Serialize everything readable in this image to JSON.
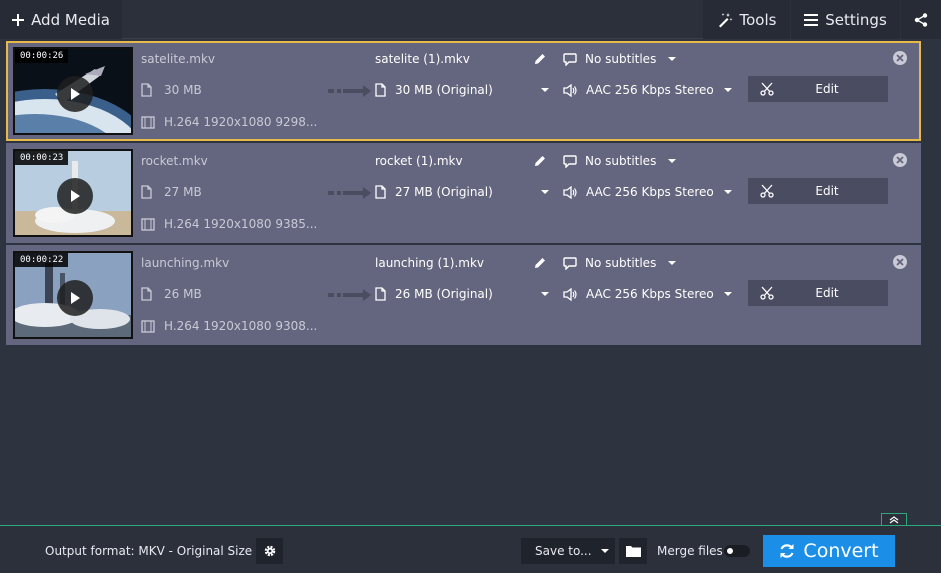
{
  "toolbar": {
    "add_media_label": "Add Media",
    "tools_label": "Tools",
    "settings_label": "Settings"
  },
  "files": [
    {
      "duration": "00:00:26",
      "source_name": "satelite.mkv",
      "source_size": "30 MB",
      "source_codec": "H.264 1920x1080 9298...",
      "output_name": "satelite (1).mkv",
      "output_size": "30 MB (Original)",
      "subtitles": "No subtitles",
      "audio": "AAC 256 Kbps Stereo",
      "edit_label": "Edit",
      "selected": true
    },
    {
      "duration": "00:00:23",
      "source_name": "rocket.mkv",
      "source_size": "27 MB",
      "source_codec": "H.264 1920x1080 9385...",
      "output_name": "rocket (1).mkv",
      "output_size": "27 MB (Original)",
      "subtitles": "No subtitles",
      "audio": "AAC 256 Kbps Stereo",
      "edit_label": "Edit",
      "selected": false
    },
    {
      "duration": "00:00:22",
      "source_name": "launching.mkv",
      "source_size": "26 MB",
      "source_codec": "H.264 1920x1080 9308...",
      "output_name": "launching (1).mkv",
      "output_size": "26 MB (Original)",
      "subtitles": "No subtitles",
      "audio": "AAC 256 Kbps Stereo",
      "edit_label": "Edit",
      "selected": false
    }
  ],
  "bottom": {
    "output_format": "Output format: MKV - Original Size",
    "save_to_label": "Save to...",
    "merge_label": "Merge files",
    "merge_enabled": false,
    "convert_label": "Convert"
  },
  "colors": {
    "accent": "#1b8fe8",
    "selection": "#e6b94a",
    "bottom_border": "#2ea77a",
    "row_bg": "#63667e"
  },
  "icons": [
    "plus-icon",
    "magic-wand-icon",
    "menu-icon",
    "share-icon",
    "play-icon",
    "file-icon",
    "film-icon",
    "arrow-right-icon",
    "pencil-icon",
    "speech-bubble-icon",
    "speaker-icon",
    "scissors-icon",
    "close-icon",
    "chevrons-up-icon",
    "gear-icon",
    "folder-icon",
    "refresh-icon"
  ]
}
